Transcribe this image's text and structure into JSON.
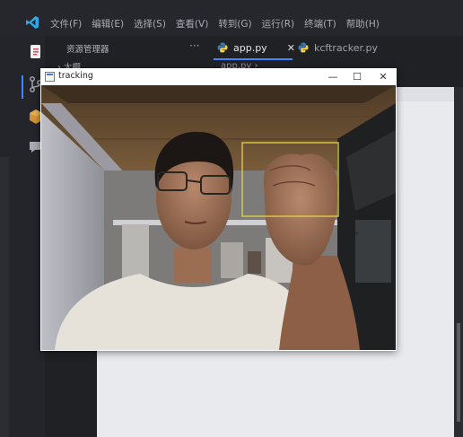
{
  "menu": [
    "文件(F)",
    "编辑(E)",
    "选择(S)",
    "查看(V)",
    "转到(G)",
    "运行(R)",
    "终端(T)",
    "帮助(H)"
  ],
  "explorer": {
    "title": "资源管理器",
    "more": "···",
    "row": "› 大棚"
  },
  "tabs": [
    {
      "label": "app.py",
      "close": "✕"
    },
    {
      "label": "kcftracker.py"
    }
  ],
  "breadcrumb": "app.py ›",
  "tracking_window": {
    "title": "tracking",
    "minimize": "—",
    "maximize": "☐",
    "close": "✕",
    "tracker_box_color": "#e3d53a"
  },
  "colors": {
    "accent": "#3e87ff",
    "vscode_logo": "#2ea8e8",
    "python_blue": "#3b77a8",
    "python_yellow": "#f5d145"
  },
  "icons": [
    "vscode-logo-icon",
    "explorer-icon",
    "source-control-icon",
    "extensions-icon",
    "chat-icon",
    "python-file-icon",
    "opencv-window-icon",
    "crosshair-cursor-icon"
  ]
}
